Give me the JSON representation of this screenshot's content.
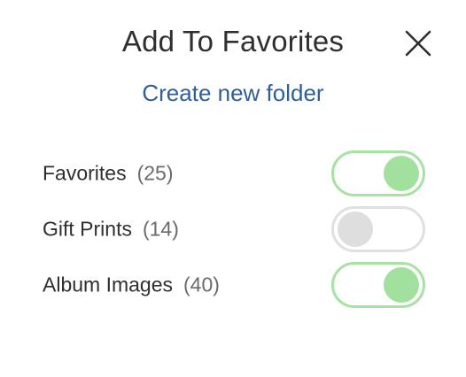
{
  "dialog": {
    "title": "Add To Favorites",
    "close_icon": "close-icon",
    "create_link": "Create new folder"
  },
  "folders": [
    {
      "name": "Favorites",
      "count": "(25)",
      "enabled": true
    },
    {
      "name": "Gift Prints",
      "count": "(14)",
      "enabled": false
    },
    {
      "name": "Album Images",
      "count": "(40)",
      "enabled": true
    }
  ],
  "colors": {
    "toggle_on": "#a2e09d",
    "toggle_off": "#dedede",
    "link": "#2e5f99"
  }
}
